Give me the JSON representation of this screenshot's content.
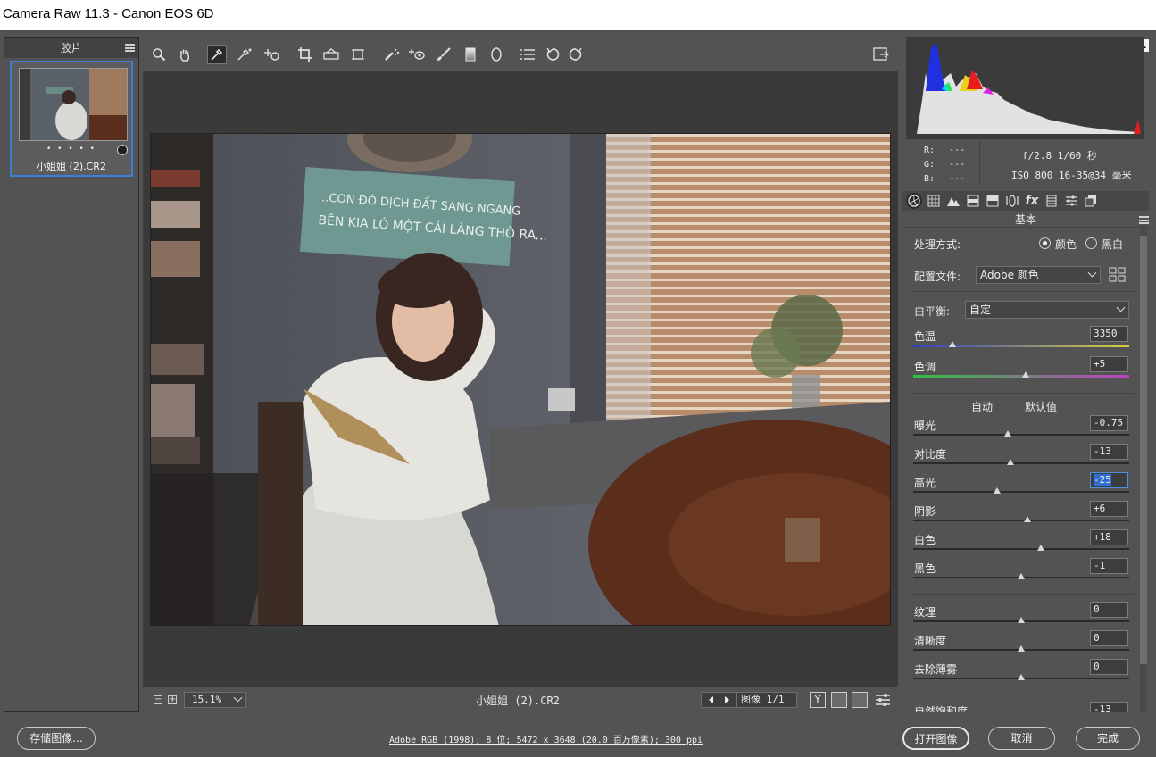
{
  "window": {
    "title": "Camera Raw 11.3 -  Canon EOS 6D"
  },
  "filmstrip": {
    "header": "胶片",
    "thumbnail_label": "小姐姐 (2).CR2",
    "rating_dots": "• • • • •"
  },
  "toolbar": {
    "tools": [
      "zoom-icon",
      "hand-icon",
      "white-balance-icon",
      "color-sampler-icon",
      "target-adjust-icon",
      "crop-icon",
      "straighten-icon",
      "transform-icon",
      "spot-removal-icon",
      "red-eye-icon",
      "adjustment-brush-icon",
      "graduated-filter-icon",
      "radial-filter-icon",
      "preferences-list-icon",
      "rotate-left-icon",
      "rotate-right-icon"
    ],
    "active_tool": "white-balance-icon"
  },
  "bottombar": {
    "zoom": "15.1%",
    "filename": "小姐姐 (2).CR2",
    "image_counter": "图像 1/1"
  },
  "info": {
    "r_label": "R:",
    "g_label": "G:",
    "b_label": "B:",
    "rgb_placeholder": "---",
    "aperture_shutter": "f/2.8  1/60 秒",
    "iso_lens": "ISO 800  16-35@34 毫米"
  },
  "basic": {
    "section_title": "基本",
    "treatment_label": "处理方式:",
    "treatment_color": "颜色",
    "treatment_bw": "黑白",
    "treatment_selected": "颜色",
    "profile_label": "配置文件:",
    "profile_value": "Adobe 颜色",
    "wb_label": "白平衡:",
    "wb_value": "自定",
    "auto_link": "自动",
    "default_link": "默认值"
  },
  "sliders": {
    "temperature": {
      "label": "色温",
      "value": "3350",
      "fraction": 0.18
    },
    "tint": {
      "label": "色调",
      "value": "+5",
      "fraction": 0.52
    },
    "exposure": {
      "label": "曝光",
      "value": "-0.75",
      "fraction": 0.44
    },
    "contrast": {
      "label": "对比度",
      "value": "-13",
      "fraction": 0.45
    },
    "highlights": {
      "label": "高光",
      "value": "-25",
      "fraction": 0.39
    },
    "shadows": {
      "label": "阴影",
      "value": "+6",
      "fraction": 0.53
    },
    "whites": {
      "label": "白色",
      "value": "+18",
      "fraction": 0.59
    },
    "blacks": {
      "label": "黑色",
      "value": "-1",
      "fraction": 0.5
    },
    "texture": {
      "label": "纹理",
      "value": "0",
      "fraction": 0.5
    },
    "clarity": {
      "label": "清晰度",
      "value": "0",
      "fraction": 0.5
    },
    "dehaze": {
      "label": "去除薄雾",
      "value": "0",
      "fraction": 0.5
    },
    "vibrance": {
      "label": "自然饱和度",
      "value": "-13"
    }
  },
  "footer": {
    "save_button": "存储图像...",
    "workflow_link": "Adobe RGB (1998); 8 位; 5472 x 3648 (20.0 百万像素); 300 ppi",
    "open_button": "打开图像",
    "cancel_button": "取消",
    "done_button": "完成"
  },
  "colors": {
    "accent_blue": "#3d7fd4",
    "panel_bg": "#535353",
    "preview_bg": "#3a3a3a"
  }
}
